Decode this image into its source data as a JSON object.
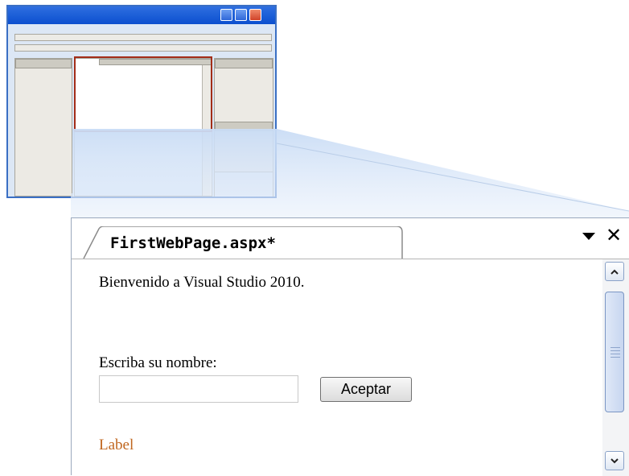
{
  "document": {
    "tab_title": "FirstWebPage.aspx*",
    "close_glyph": "✕",
    "menu_icon": "triangle-down-icon",
    "welcome_text": "Bienvenido a Visual Studio 2010.",
    "name_label": "Escriba su nombre:",
    "name_input": {
      "value": "",
      "placeholder": ""
    },
    "accept_button": "Aceptar",
    "label_text": "Label"
  },
  "colors": {
    "titlebar_blue": "#0b4fcf",
    "highlight_frame": "#a32d18",
    "label_orange": "#c0661e",
    "thumbnail_bg": "#dce7f5"
  }
}
